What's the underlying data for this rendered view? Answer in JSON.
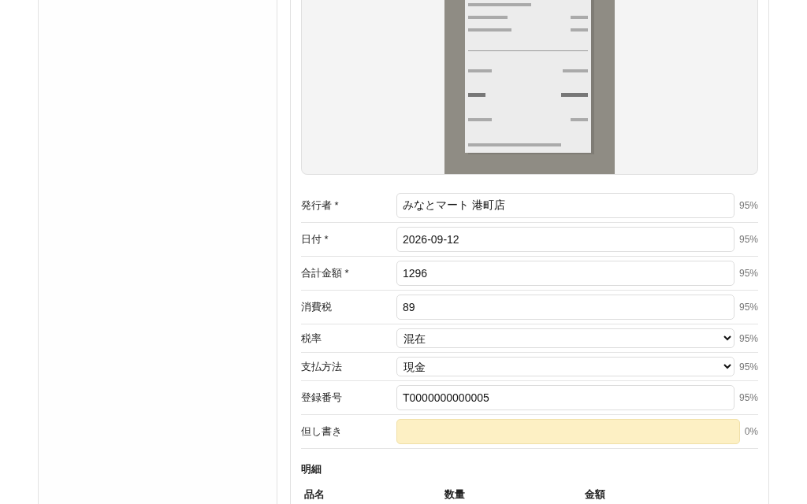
{
  "fields": [
    {
      "label": "発行者 *",
      "kind": "text",
      "value": "みなとマート 港町店",
      "confidence": "95%",
      "highlighted": false
    },
    {
      "label": "日付 *",
      "kind": "text",
      "value": "2026-09-12",
      "confidence": "95%",
      "highlighted": false
    },
    {
      "label": "合計金額 *",
      "kind": "text",
      "value": "1296",
      "confidence": "95%",
      "highlighted": false
    },
    {
      "label": "消費税",
      "kind": "text",
      "value": "89",
      "confidence": "95%",
      "highlighted": false
    },
    {
      "label": "税率",
      "kind": "select",
      "value": "混在",
      "confidence": "95%",
      "highlighted": false
    },
    {
      "label": "支払方法",
      "kind": "select",
      "value": "現金",
      "confidence": "95%",
      "highlighted": false
    },
    {
      "label": "登録番号",
      "kind": "text",
      "value": "T0000000000005",
      "confidence": "95%",
      "highlighted": false
    },
    {
      "label": "但し書き",
      "kind": "text",
      "confidence": "0%",
      "highlighted": true
    }
  ],
  "line_items": {
    "title": "明細",
    "columns": [
      "品名",
      "数量",
      "金額"
    ]
  }
}
